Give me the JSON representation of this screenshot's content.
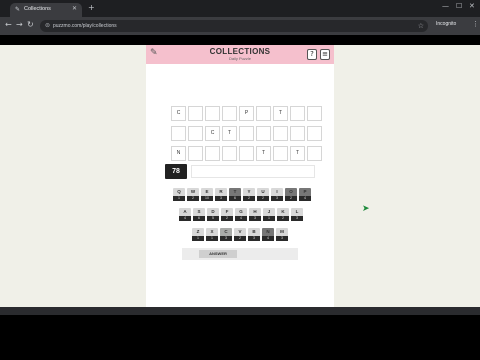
{
  "browser": {
    "tab_title": "Collections",
    "tab_favicon": "feather-icon",
    "url": "puzzmo.com/play/collections",
    "incognito_label": "Incognito",
    "controls": {
      "minimize": "—",
      "maximize": "☐",
      "close": "✕"
    }
  },
  "game": {
    "title": "COLLECTIONS",
    "subtitle": "Daily Puzzle",
    "help_label": "?",
    "menu_label": "≡",
    "score": "78",
    "answer_label": "ANSWER",
    "board": [
      [
        "C",
        "",
        "",
        "",
        "P",
        "",
        "T",
        "",
        ""
      ],
      [
        "",
        "",
        "C",
        "T",
        "",
        "",
        "",
        "",
        ""
      ],
      [
        "N",
        "",
        "",
        "",
        "",
        "T",
        "",
        "T",
        ""
      ]
    ],
    "keyboard": [
      [
        {
          "l": "Q",
          "n": "1",
          "s": "light"
        },
        {
          "l": "W",
          "n": "2",
          "s": "light"
        },
        {
          "l": "E",
          "n": "10",
          "s": "light"
        },
        {
          "l": "R",
          "n": "3",
          "s": "light"
        },
        {
          "l": "T",
          "n": "6",
          "s": "dark"
        },
        {
          "l": "Y",
          "n": "2",
          "s": "light"
        },
        {
          "l": "U",
          "n": "2",
          "s": "light"
        },
        {
          "l": "I",
          "n": "3",
          "s": "light"
        },
        {
          "l": "O",
          "n": "2",
          "s": "dark"
        },
        {
          "l": "P",
          "n": "4",
          "s": "dark"
        }
      ],
      [
        {
          "l": "A",
          "n": "4",
          "s": "light"
        },
        {
          "l": "S",
          "n": "6",
          "s": "light"
        },
        {
          "l": "D",
          "n": "5",
          "s": "light"
        },
        {
          "l": "F",
          "n": "2",
          "s": "light"
        },
        {
          "l": "G",
          "n": "4",
          "s": "light"
        },
        {
          "l": "H",
          "n": "3",
          "s": "light"
        },
        {
          "l": "J",
          "n": "1",
          "s": "light"
        },
        {
          "l": "K",
          "n": "2",
          "s": "light"
        },
        {
          "l": "L",
          "n": "3",
          "s": "light"
        }
      ],
      [
        {
          "l": "Z",
          "n": "1",
          "s": "light"
        },
        {
          "l": "X",
          "n": "1",
          "s": "light"
        },
        {
          "l": "C",
          "n": "3",
          "s": "mid"
        },
        {
          "l": "V",
          "n": "2",
          "s": "light"
        },
        {
          "l": "B",
          "n": "3",
          "s": "light"
        },
        {
          "l": "N",
          "n": "4",
          "s": "dark"
        },
        {
          "l": "M",
          "n": "3",
          "s": "light"
        }
      ]
    ]
  },
  "colors": {
    "header_pink": "#f5c0cd",
    "page_bg": "#f0f0e8",
    "key_light": "#d8d8d8",
    "key_dark": "#777777",
    "cursor_green": "#1d8a3a"
  }
}
